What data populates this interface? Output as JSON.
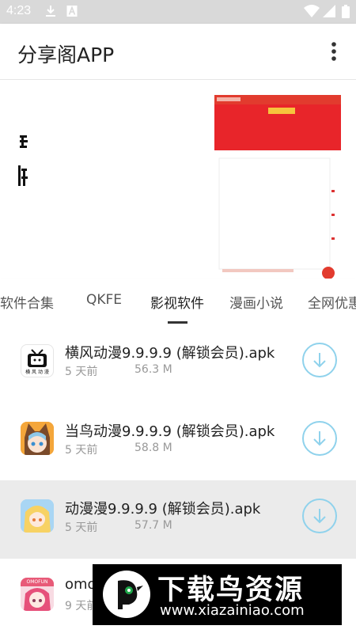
{
  "status_bar": {
    "time": "4:23",
    "icons": [
      "download-icon",
      "a-notification-icon",
      "wifi-icon",
      "signal-icon",
      "battery-icon"
    ]
  },
  "app_bar": {
    "title": "分享阁APP",
    "menu_icon": "more-vert-icon"
  },
  "tabs": [
    {
      "label": "软件合集",
      "selected": false
    },
    {
      "label": "QKFE",
      "selected": false
    },
    {
      "label": "影视软件",
      "selected": true
    },
    {
      "label": "漫画小说",
      "selected": false
    },
    {
      "label": "全网优惠",
      "selected": false
    }
  ],
  "list": [
    {
      "name": "横风动漫9.9.9.9 (解锁会员).apk",
      "time": "5 天前",
      "size": "56.3 M",
      "icon": "tv-app-icon",
      "icon_caption": "横 风 动 漫"
    },
    {
      "name": "当鸟动漫9.9.9.9 (解锁会员).apk",
      "time": "5 天前",
      "size": "58.8 M",
      "icon": "anime-girl-hood-app-icon"
    },
    {
      "name": "动漫漫9.9.9.9 (解锁会员).apk",
      "time": "5 天前",
      "size": "57.7 M",
      "icon": "anime-blonde-girl-app-icon",
      "highlighted": true
    },
    {
      "name": "omo",
      "time": "9 天前",
      "icon": "anime-pink-hair-app-icon",
      "icon_caption": "OMOFUN"
    }
  ],
  "download_icon": "download-circle-icon",
  "watermark": {
    "title": "下载鸟资源",
    "url": "www.xiazainiao.com"
  },
  "colors": {
    "status_bar": "#d9d9d9",
    "download_ring": "#8fd2ec",
    "highlight_row": "#ebebeb",
    "banner_red": "#e8252a"
  }
}
